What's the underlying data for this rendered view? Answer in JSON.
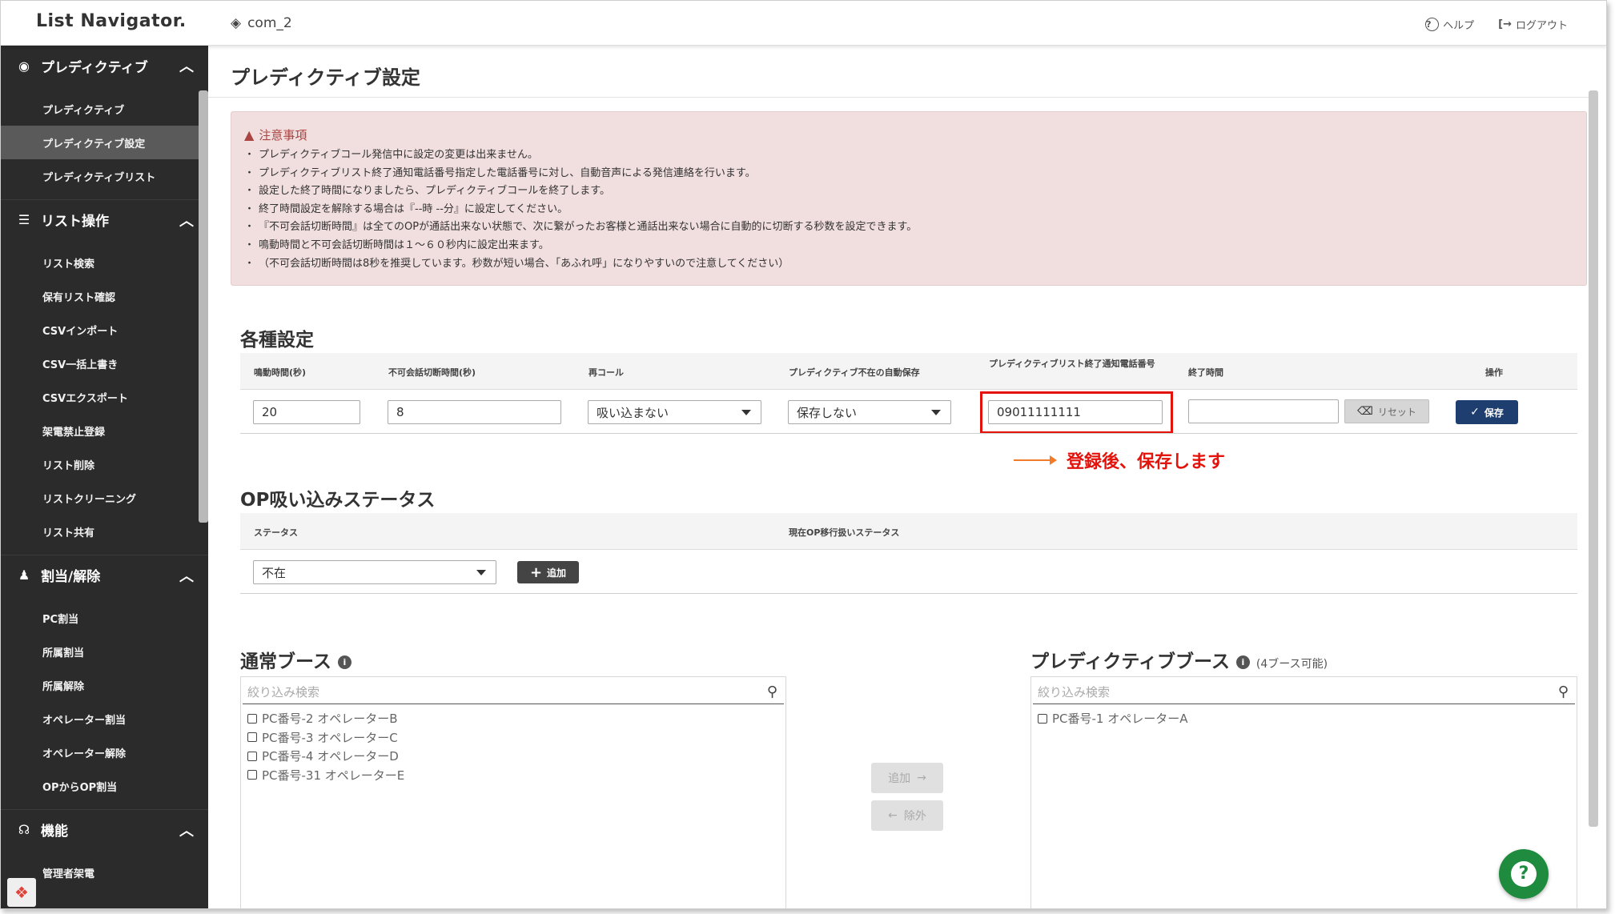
{
  "header": {
    "logo": "List Navigator.",
    "company": "com_2",
    "help": "ヘルプ",
    "logout": "ログアウト"
  },
  "sidebar": {
    "sections": [
      {
        "label": "プレディクティブ",
        "icon": "broadcast-icon",
        "items": [
          "プレディクティブ",
          "プレディクティブ設定",
          "プレディクティブリスト"
        ],
        "active_index": 1
      },
      {
        "label": "リスト操作",
        "icon": "list-icon",
        "items": [
          "リスト検索",
          "保有リスト確認",
          "CSVインポート",
          "CSV一括上書き",
          "CSVエクスポート",
          "架電禁止登録",
          "リスト削除",
          "リストクリーニング",
          "リスト共有"
        ]
      },
      {
        "label": "割当/解除",
        "icon": "user-check-icon",
        "items": [
          "PC割当",
          "所属割当",
          "所属解除",
          "オペレーター割当",
          "オペレーター解除",
          "OPからOP割当"
        ]
      },
      {
        "label": "機能",
        "icon": "headset-icon",
        "items": [
          "管理者架電"
        ]
      }
    ]
  },
  "page": {
    "title": "プレディクティブ設定",
    "notice": {
      "title": "注意事項",
      "items": [
        "プレディクティブコール発信中に設定の変更は出来ません。",
        "プレディクティブリスト終了通知電話番号指定した電話番号に対し、自動音声による発信連絡を行います。",
        "設定した終了時間になりましたら、プレディクティブコールを終了します。",
        "終了時間設定を解除する場合は『--時 --分』に設定してください。",
        "『不可会話切断時間』は全てのOPが通話出来ない状態で、次に繋がったお客様と通話出来ない場合に自動的に切断する秒数を設定できます。",
        "鳴動時間と不可会話切断時間は１～６０秒内に設定出来ます。",
        "（不可会話切断時間は8秒を推奨しています。秒数が短い場合、「あふれ呼」になりやすいので注意してください）"
      ]
    },
    "settings": {
      "title": "各種設定",
      "columns": [
        "鳴動時間(秒)",
        "不可会話切断時間(秒)",
        "再コール",
        "プレディクティブ不在の自動保存",
        "プレディクティブリスト終了通知電話番号",
        "終了時間",
        "操作"
      ],
      "ring_time": "20",
      "cut_time": "8",
      "recall": "吸い込まない",
      "auto_save": "保存しない",
      "notify_phone": "09011111111",
      "end_time": "",
      "reset_label": "リセット",
      "save_label": "保存"
    },
    "annotation": "登録後、保存します",
    "op_status": {
      "title": "OP吸い込みステータス",
      "columns": [
        "ステータス",
        "現在OP移行扱いステータス"
      ],
      "status_value": "不在",
      "add_label": "追加"
    },
    "normal_booth": {
      "title": "通常ブース",
      "search_placeholder": "絞り込み検索",
      "items": [
        "PC番号-2 オペレーターB",
        "PC番号-3 オペレーターC",
        "PC番号-4 オペレーターD",
        "PC番号-31 オペレーターE"
      ]
    },
    "transfer": {
      "add_label": "追加",
      "remove_label": "除外"
    },
    "predictive_booth": {
      "title": "プレディクティブブース",
      "note": "(4ブース可能)",
      "search_placeholder": "絞り込み検索",
      "items": [
        "PC番号-1 オペレーターA"
      ]
    }
  },
  "colors": {
    "sidebar_bg": "#2b2b2b",
    "sidebar_active": "#5a5a5a",
    "notice_bg": "#f1dede",
    "notice_title": "#a94442",
    "save_button": "#1d3e6e",
    "highlight": "#e3120b",
    "annotation_arrow": "#f07c2a",
    "help_fab": "#1e8b3e"
  }
}
